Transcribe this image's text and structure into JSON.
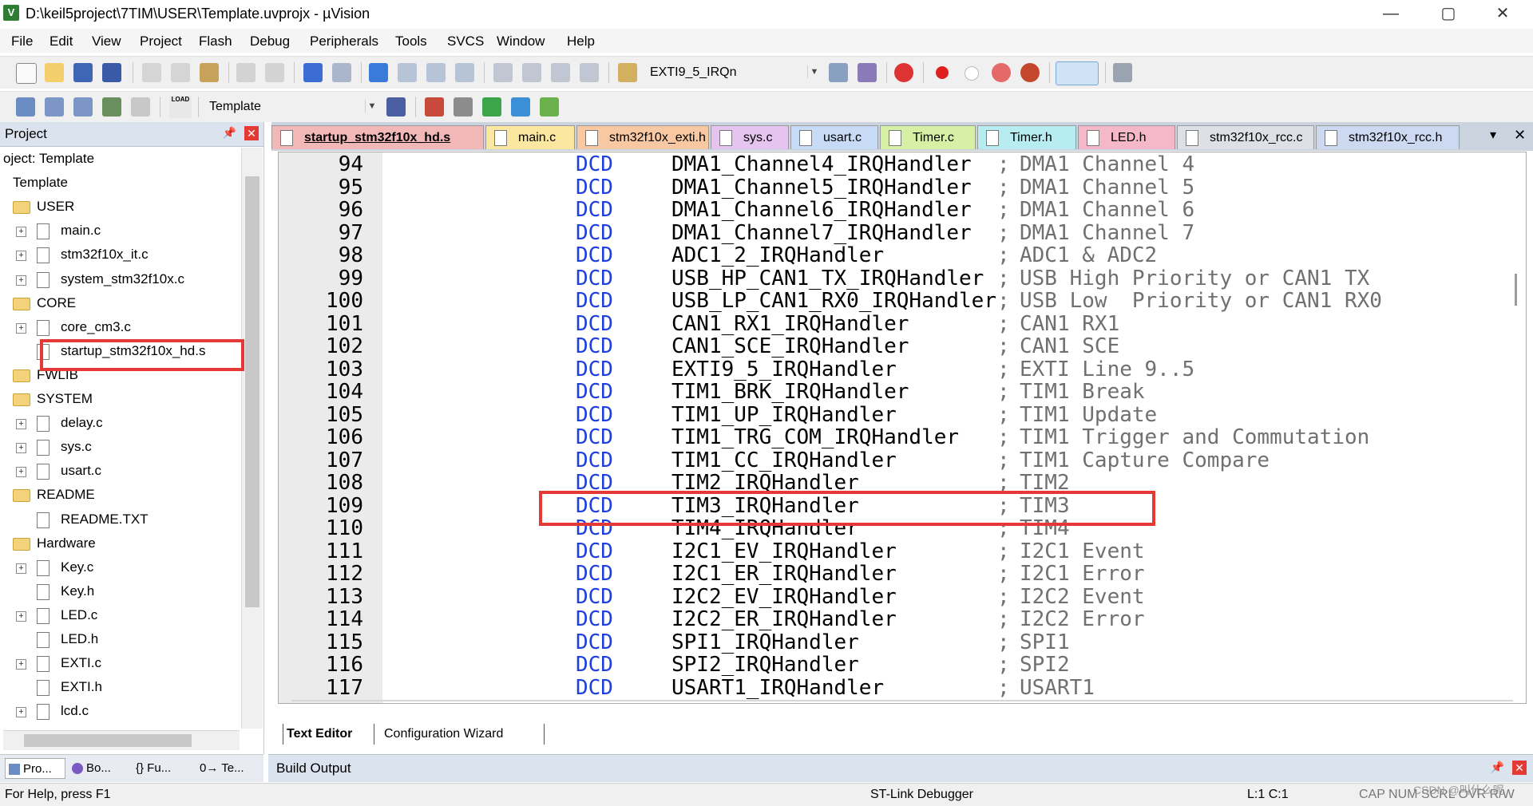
{
  "window": {
    "title": "D:\\keil5project\\7TIM\\USER\\Template.uvprojx - µVision",
    "app_icon": "V",
    "minimize": "—",
    "maximize": "▢",
    "close": "✕"
  },
  "menu": [
    "File",
    "Edit",
    "View",
    "Project",
    "Flash",
    "Debug",
    "Peripherals",
    "Tools",
    "SVCS",
    "Window",
    "Help"
  ],
  "toolbar": {
    "function_combo": "EXTI9_5_IRQn",
    "target_combo": "Template",
    "load_label": "LOAD"
  },
  "project_panel": {
    "title": "Project",
    "pin": "📌",
    "close": "✕",
    "tree": [
      {
        "label": "oject: Template",
        "level": 0,
        "kind": "root"
      },
      {
        "label": "Template",
        "level": 0,
        "kind": "target"
      },
      {
        "label": "USER",
        "level": 1,
        "kind": "folder"
      },
      {
        "label": "main.c",
        "level": 2,
        "kind": "file",
        "expander": "+"
      },
      {
        "label": "stm32f10x_it.c",
        "level": 2,
        "kind": "file",
        "expander": "+"
      },
      {
        "label": "system_stm32f10x.c",
        "level": 2,
        "kind": "file",
        "expander": "+"
      },
      {
        "label": "CORE",
        "level": 1,
        "kind": "folder"
      },
      {
        "label": "core_cm3.c",
        "level": 2,
        "kind": "file",
        "expander": "+"
      },
      {
        "label": "startup_stm32f10x_hd.s",
        "level": 2,
        "kind": "file",
        "expander": ""
      },
      {
        "label": "FWLIB",
        "level": 1,
        "kind": "folder"
      },
      {
        "label": "SYSTEM",
        "level": 1,
        "kind": "folder"
      },
      {
        "label": "delay.c",
        "level": 2,
        "kind": "file",
        "expander": "+"
      },
      {
        "label": "sys.c",
        "level": 2,
        "kind": "file",
        "expander": "+"
      },
      {
        "label": "usart.c",
        "level": 2,
        "kind": "file",
        "expander": "+"
      },
      {
        "label": "README",
        "level": 1,
        "kind": "folder"
      },
      {
        "label": "README.TXT",
        "level": 2,
        "kind": "file",
        "expander": ""
      },
      {
        "label": "Hardware",
        "level": 1,
        "kind": "folder"
      },
      {
        "label": "Key.c",
        "level": 2,
        "kind": "file",
        "expander": "+"
      },
      {
        "label": "Key.h",
        "level": 2,
        "kind": "file",
        "expander": ""
      },
      {
        "label": "LED.c",
        "level": 2,
        "kind": "file",
        "expander": "+"
      },
      {
        "label": "LED.h",
        "level": 2,
        "kind": "file",
        "expander": ""
      },
      {
        "label": "EXTI.c",
        "level": 2,
        "kind": "file",
        "expander": "+"
      },
      {
        "label": "EXTI.h",
        "level": 2,
        "kind": "file",
        "expander": ""
      },
      {
        "label": "lcd.c",
        "level": 2,
        "kind": "file",
        "expander": "+"
      }
    ],
    "highlighted_item": "startup_stm32f10x_hd.s"
  },
  "panel_tabs": [
    "Pro...",
    "Bo...",
    "{} Fu...",
    "0→ Te..."
  ],
  "editor_tabs": [
    {
      "label": "startup_stm32f10x_hd.s",
      "color": "#f2b7b7",
      "active": true
    },
    {
      "label": "main.c",
      "color": "#fbe7a0",
      "active": false
    },
    {
      "label": "stm32f10x_exti.h",
      "color": "#f7c8a1",
      "active": false
    },
    {
      "label": "sys.c",
      "color": "#e5c4f0",
      "active": false
    },
    {
      "label": "usart.c",
      "color": "#c7daf6",
      "active": false
    },
    {
      "label": "Timer.c",
      "color": "#d6f1a6",
      "active": false
    },
    {
      "label": "Timer.h",
      "color": "#b7ecf0",
      "active": false
    },
    {
      "label": "LED.h",
      "color": "#f5b8c9",
      "active": false
    },
    {
      "label": "stm32f10x_rcc.c",
      "color": "#dde1e6",
      "active": false
    },
    {
      "label": "stm32f10x_rcc.h",
      "color": "#ccd9f0",
      "active": false
    }
  ],
  "editor_tab_controls": {
    "menu": "▾",
    "close": "✕"
  },
  "code_lines": [
    {
      "num": "94",
      "kw": "DCD",
      "ident": "DMA1_Channel4_IRQHandler",
      "semi": ";",
      "comment": "DMA1 Channel 4"
    },
    {
      "num": "95",
      "kw": "DCD",
      "ident": "DMA1_Channel5_IRQHandler",
      "semi": ";",
      "comment": "DMA1 Channel 5"
    },
    {
      "num": "96",
      "kw": "DCD",
      "ident": "DMA1_Channel6_IRQHandler",
      "semi": ";",
      "comment": "DMA1 Channel 6"
    },
    {
      "num": "97",
      "kw": "DCD",
      "ident": "DMA1_Channel7_IRQHandler",
      "semi": ";",
      "comment": "DMA1 Channel 7"
    },
    {
      "num": "98",
      "kw": "DCD",
      "ident": "ADC1_2_IRQHandler",
      "semi": ";",
      "comment": "ADC1 & ADC2"
    },
    {
      "num": "99",
      "kw": "DCD",
      "ident": "USB_HP_CAN1_TX_IRQHandler",
      "semi": ";",
      "comment": "USB High Priority or CAN1 TX"
    },
    {
      "num": "100",
      "kw": "DCD",
      "ident": "USB_LP_CAN1_RX0_IRQHandler",
      "semi": ";",
      "comment": "USB Low  Priority or CAN1 RX0"
    },
    {
      "num": "101",
      "kw": "DCD",
      "ident": "CAN1_RX1_IRQHandler",
      "semi": ";",
      "comment": "CAN1 RX1"
    },
    {
      "num": "102",
      "kw": "DCD",
      "ident": "CAN1_SCE_IRQHandler",
      "semi": ";",
      "comment": "CAN1 SCE"
    },
    {
      "num": "103",
      "kw": "DCD",
      "ident": "EXTI9_5_IRQHandler",
      "semi": ";",
      "comment": "EXTI Line 9..5"
    },
    {
      "num": "104",
      "kw": "DCD",
      "ident": "TIM1_BRK_IRQHandler",
      "semi": ";",
      "comment": "TIM1 Break"
    },
    {
      "num": "105",
      "kw": "DCD",
      "ident": "TIM1_UP_IRQHandler",
      "semi": ";",
      "comment": "TIM1 Update"
    },
    {
      "num": "106",
      "kw": "DCD",
      "ident": "TIM1_TRG_COM_IRQHandler",
      "semi": ";",
      "comment": "TIM1 Trigger and Commutation"
    },
    {
      "num": "107",
      "kw": "DCD",
      "ident": "TIM1_CC_IRQHandler",
      "semi": ";",
      "comment": "TIM1 Capture Compare"
    },
    {
      "num": "108",
      "kw": "DCD",
      "ident": "TIM2_IRQHandler",
      "semi": ";",
      "comment": "TIM2"
    },
    {
      "num": "109",
      "kw": "DCD",
      "ident": "TIM3_IRQHandler",
      "semi": ";",
      "comment": "TIM3"
    },
    {
      "num": "110",
      "kw": "DCD",
      "ident": "TIM4_IRQHandler",
      "semi": ";",
      "comment": "TIM4"
    },
    {
      "num": "111",
      "kw": "DCD",
      "ident": "I2C1_EV_IRQHandler",
      "semi": ";",
      "comment": "I2C1 Event"
    },
    {
      "num": "112",
      "kw": "DCD",
      "ident": "I2C1_ER_IRQHandler",
      "semi": ";",
      "comment": "I2C1 Error"
    },
    {
      "num": "113",
      "kw": "DCD",
      "ident": "I2C2_EV_IRQHandler",
      "semi": ";",
      "comment": "I2C2 Event"
    },
    {
      "num": "114",
      "kw": "DCD",
      "ident": "I2C2_ER_IRQHandler",
      "semi": ";",
      "comment": "I2C2 Error"
    },
    {
      "num": "115",
      "kw": "DCD",
      "ident": "SPI1_IRQHandler",
      "semi": ";",
      "comment": "SPI1"
    },
    {
      "num": "116",
      "kw": "DCD",
      "ident": "SPI2_IRQHandler",
      "semi": ";",
      "comment": "SPI2"
    },
    {
      "num": "117",
      "kw": "DCD",
      "ident": "USART1_IRQHandler",
      "semi": ";",
      "comment": "USART1"
    }
  ],
  "highlighted_line": "109",
  "bottom_editor_tabs": [
    "Text Editor",
    "Configuration Wizard"
  ],
  "build_output": {
    "title": "Build Output",
    "pin": "📌",
    "close": "✕"
  },
  "status": {
    "help": "For Help, press F1",
    "debugger": "ST-Link Debugger",
    "position": "L:1 C:1",
    "indicators": "CAP  NUM  SCRL  OVR  R/W",
    "watermark": "CSDN @叫什么呢"
  },
  "colors": {
    "keyword_blue": "#1e3fe0",
    "highlight_red": "#e53935",
    "comment_gray": "#707070"
  }
}
